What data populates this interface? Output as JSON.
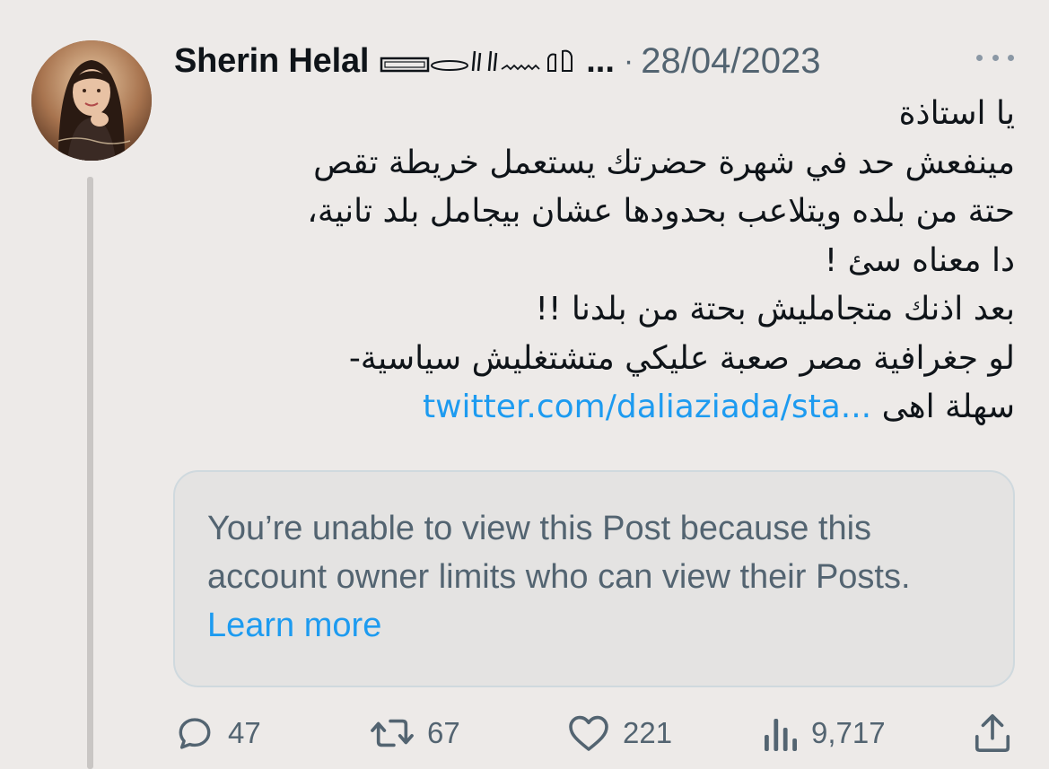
{
  "tweet": {
    "author_name": "Sherin Helal",
    "ellipsis": "...",
    "separator": "·",
    "date": "28/04/2023",
    "body_lines": [
      "يا استاذة",
      "مينفعش حد في شهرة حضرتك يستعمل خريطة تقص",
      "حتة من بلده ويتلاعب بحدودها عشان بيجامل بلد تانية،",
      "دا معناه سئ !",
      "بعد اذنك متجامليش بحتة من بلدنا !!",
      "لو جغرافية مصر صعبة عليكي متشتغليش سياسية-"
    ],
    "last_line_text": "سهلة اهى",
    "link_text": "twitter.com/daliaziada/sta...",
    "quoted_notice": "You’re unable to view this Post because this account owner limits who can view their Posts.",
    "learn_more": "Learn more"
  },
  "actions": {
    "replies": "47",
    "reposts": "67",
    "likes": "221",
    "views": "9,717"
  },
  "colors": {
    "background": "#edeae8",
    "link": "#1d9bf0",
    "muted": "#536471",
    "text": "#0f1419"
  },
  "icons": [
    "reply-icon",
    "repost-icon",
    "like-icon",
    "views-icon",
    "share-icon",
    "more-icon"
  ]
}
